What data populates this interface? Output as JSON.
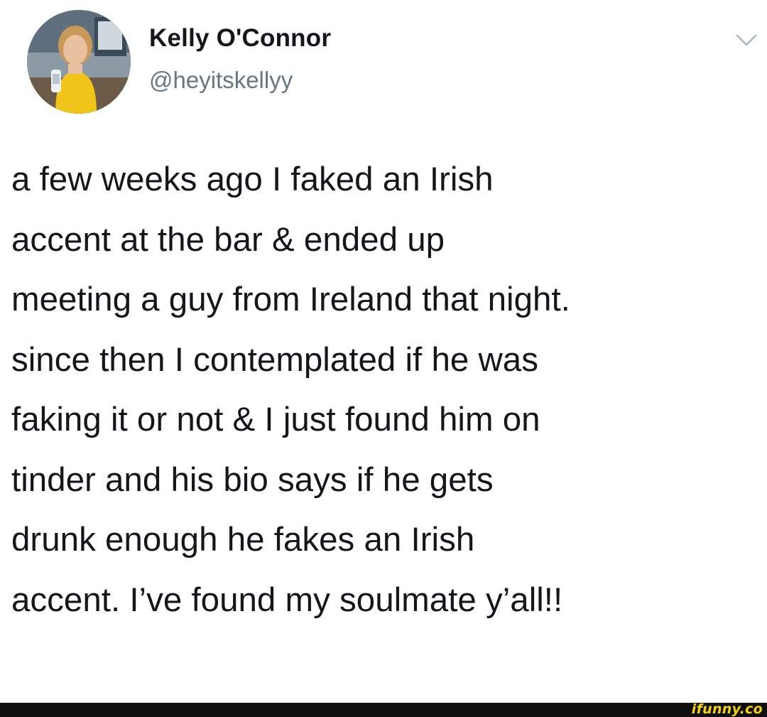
{
  "tweet": {
    "author": {
      "display_name": "Kelly O'Connor",
      "handle": "@heyitskellyy",
      "avatar_icon": "profile-photo"
    },
    "menu_icon": "chevron-down-icon",
    "text_lines": [
      "a few weeks ago I faked an Irish",
      "accent at the bar & ended up",
      "meeting a guy from Ireland that night.",
      "since then I contemplated if he was",
      "faking it or not & I just found him on",
      "tinder and his bio says if he gets",
      "drunk enough he fakes an Irish",
      "accent. I’ve found my soulmate y’all!!"
    ]
  },
  "watermark": {
    "text": "ifunny.co",
    "color": "#f5d20a"
  },
  "colors": {
    "text_primary": "#14171a",
    "text_secondary": "#657786",
    "footer_bar": "#0f0f0f"
  }
}
